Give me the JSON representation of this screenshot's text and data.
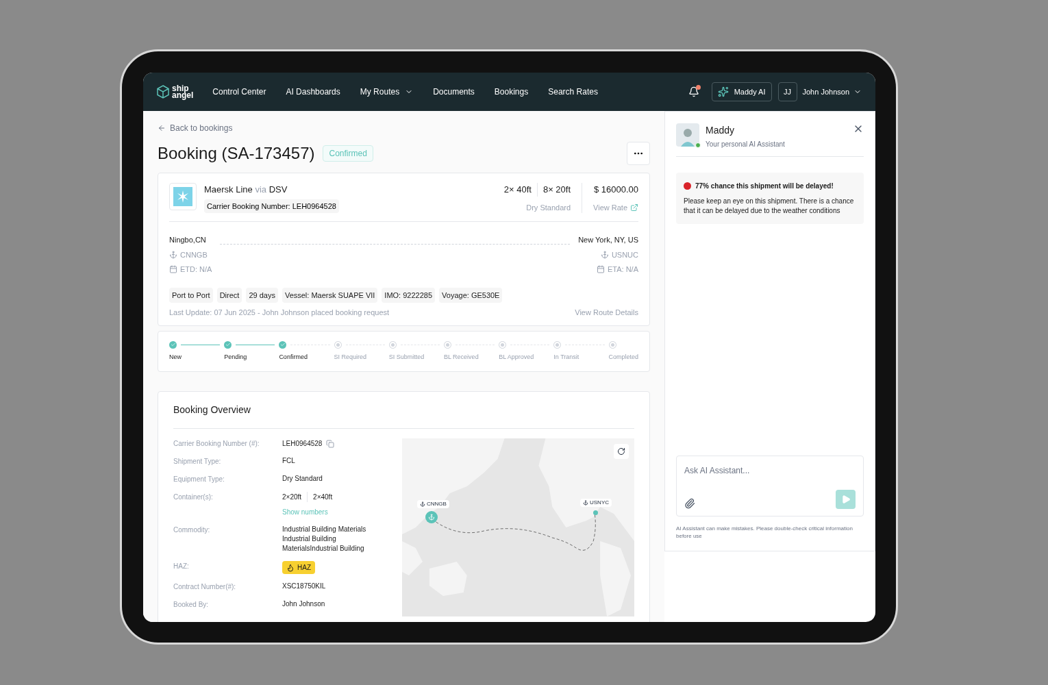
{
  "nav": {
    "logo": [
      "ship",
      "angel"
    ],
    "items": [
      {
        "label": "Control Center",
        "dropdown": false
      },
      {
        "label": "AI Dashboards",
        "dropdown": false
      },
      {
        "label": "My Routes",
        "dropdown": true
      },
      {
        "label": "Documents",
        "dropdown": false
      },
      {
        "label": "Bookings",
        "dropdown": false
      },
      {
        "label": "Search Rates",
        "dropdown": false
      }
    ],
    "notification_unread": true,
    "ai_button": "Maddy AI",
    "user_initials": "JJ",
    "user_name": "John Johnson"
  },
  "back_link": "Back to bookings",
  "title": "Booking (SA-173457)",
  "status": "Confirmed",
  "carrier": {
    "name": "Maersk Line",
    "via": "via",
    "agent": "DSV",
    "booking_number": "Carrier Booking Number: LEH0964528",
    "containers": [
      "2× 40ft",
      "8× 20ft"
    ],
    "equipment": "Dry Standard",
    "price": "$ 16000.00",
    "view_rate": "View Rate"
  },
  "route": {
    "origin": {
      "city": "Ningbo,CN",
      "port": "CNNGB",
      "date": "ETD: N/A"
    },
    "destination": {
      "city": "New York, NY, US",
      "port": "USNUC",
      "date": "ETA: N/A"
    }
  },
  "tags": [
    "Port to Port",
    "Direct",
    "29 days",
    "Vessel: Maersk SUAPE VII",
    "IMO: 9222285",
    "Voyage: GE530E"
  ],
  "last_update": "Last Update: 07 Jun 2025 - John Johnson placed booking request",
  "view_route": "View Route Details",
  "steps": [
    {
      "label": "New",
      "done": true
    },
    {
      "label": "Pending",
      "done": true
    },
    {
      "label": "Confirmed",
      "done": true
    },
    {
      "label": "SI Required",
      "done": false
    },
    {
      "label": "SI Submitted",
      "done": false
    },
    {
      "label": "BL Received",
      "done": false
    },
    {
      "label": "BL Approved",
      "done": false
    },
    {
      "label": "In Transit",
      "done": false
    },
    {
      "label": "Completed",
      "done": false
    }
  ],
  "overview": {
    "title": "Booking Overview",
    "fields": [
      {
        "label": "Carrier Booking Number (#):",
        "kind": "copy",
        "values": [
          "LEH0964528"
        ]
      },
      {
        "label": "Shipment Type:",
        "kind": "text",
        "values": [
          "FCL"
        ]
      },
      {
        "label": "Equipment Type:",
        "kind": "text",
        "values": [
          "Dry Standard"
        ]
      },
      {
        "label": "Container(s):",
        "kind": "containers",
        "values": [
          "2×20ft",
          "2×40ft"
        ],
        "link": "Show numbers"
      },
      {
        "label": "Commodity:",
        "kind": "text",
        "values": [
          "Industrial Building Materials Industrial Building MaterialsIndustrial Building"
        ]
      },
      {
        "label": "HAZ:",
        "kind": "badge",
        "values": [
          "HAZ"
        ]
      },
      {
        "label": "Contract Number(#):",
        "kind": "text",
        "values": [
          "XSC18750KIL"
        ]
      },
      {
        "label": "Booked By:",
        "kind": "text",
        "values": [
          "John Johnson"
        ]
      }
    ],
    "map": {
      "origin": "CNNGB",
      "destination": "USNYC"
    }
  },
  "assistant": {
    "name": "Maddy",
    "subtitle": "Your personal AI Assistant",
    "online": true,
    "alert_title": "77% chance this shipment will be delayed!",
    "alert_body": "Please keep an eye on this shipment. There is a chance that it can be delayed due to the weather conditions",
    "placeholder": "Ask AI Assistant...",
    "disclaimer": "AI Assistant can make mistakes. Please double-check critical information before use"
  }
}
